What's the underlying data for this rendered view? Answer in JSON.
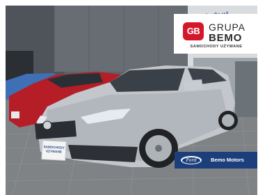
{
  "photo": {
    "subject": "silver estate car in front of a car dealership building",
    "icon": "car-photo"
  },
  "logo": {
    "mark": "GB",
    "name_line1": "GRUPA",
    "name_line2": "BEMO",
    "tagline": "SAMOCHODY UŻYWANE",
    "mark_color": "#d3182b"
  },
  "dealer": {
    "brand": "Ford",
    "name": "Bemo Motors",
    "bar_color": "#1c3f7c"
  },
  "building_sign": {
    "text": "nochody uż"
  },
  "plate": {
    "line1": "SAMOCHODY",
    "line2": "UŻYWANE"
  }
}
